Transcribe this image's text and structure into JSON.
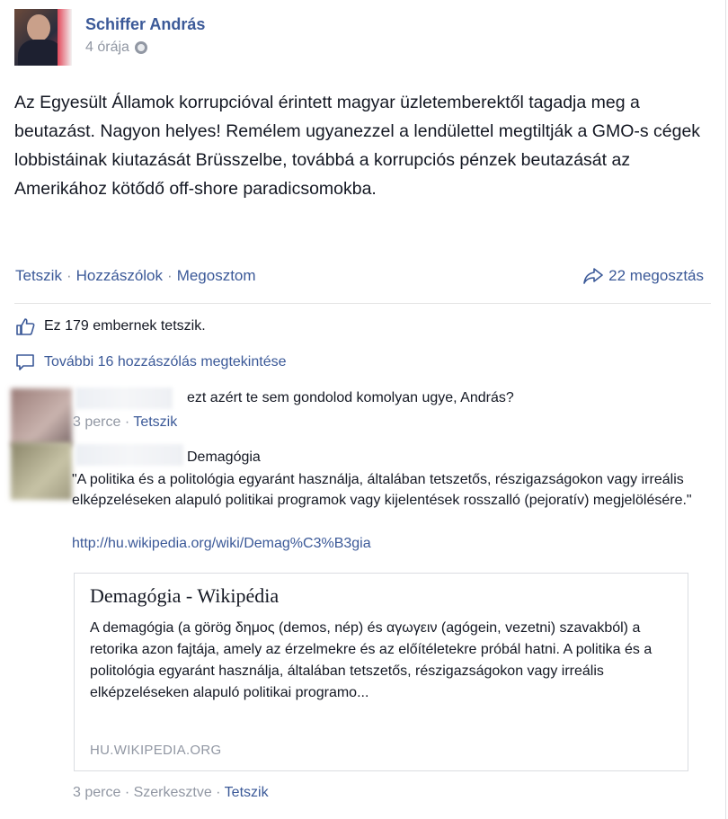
{
  "post": {
    "author": "Schiffer András",
    "time": "4 órája",
    "text": "Az Egyesült Államok korrupcióval érintett magyar üzletemberektől tagadja meg a beutazást. Nagyon helyes! Remélem ugyanezzel a lendülettel megtiltják a GMO-s cégek lobbistáinak kiutazását Brüsszelbe, továbbá a korrupciós pénzek beutazását az Amerikához kötődő off-shore paradicsomokba.",
    "actions": {
      "like": "Tetszik",
      "comment": "Hozzászólok",
      "share": "Megosztom"
    },
    "shares": "22 megosztás",
    "likes": "Ez 179 embernek tetszik.",
    "more_comments": "További 16 hozzászólás megtekintése"
  },
  "comments": [
    {
      "text": "ezt azért te sem gondolod komolyan ugye, András?",
      "time": "3 perce",
      "like": "Tetszik"
    },
    {
      "title": "Demagógia",
      "body": "\"A politika és a politológia egyaránt használja, általában tetszetős, részigazságokon vagy irreális elképzeléseken alapuló politikai programok vagy kijelentések rosszalló (pejoratív) megjelölésére.\"",
      "url": "http://hu.wikipedia.org/wiki/Demag%C3%B3gia",
      "preview": {
        "title": "Demagógia - Wikipédia",
        "body": "A demagógia (a görög δημος (demos, nép) és αγωγειν (agógein, vezetni) szavakból) a retorika azon fajtája, amely az érzelmekre és az előítéletekre próbál hatni. A politika és a politológia egyaránt használja, általában tetszetős, részigazságokon vagy irreális elképzeléseken alapuló politikai programo...",
        "domain": "HU.WIKIPEDIA.ORG"
      },
      "time": "3 perce",
      "edited": "Szerkesztve",
      "like": "Tetszik"
    }
  ],
  "colors": {
    "link": "#3b5998",
    "meta": "#9197a3",
    "text": "#141823"
  },
  "icons": [
    "globe-icon",
    "share-arrow-icon",
    "thumbs-up-icon",
    "comment-bubble-icon"
  ]
}
